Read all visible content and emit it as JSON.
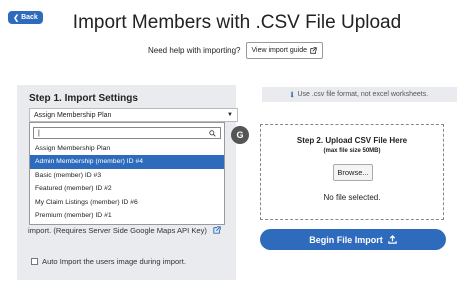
{
  "header": {
    "back_label": "Back",
    "title": "Import Members with .CSV File Upload",
    "help_text": "Need help with importing?",
    "guide_label": "View import guide"
  },
  "settings": {
    "title": "Step 1. Import Settings",
    "plan_select_value": "Assign Membership Plan",
    "dropdown": {
      "search_value": "",
      "options": [
        "Assign Membership Plan",
        "Admin Membership (member) ID #4",
        "Basic (member) ID #3",
        "Featured (member) ID #2",
        "My Claim Listings (member) ID #6",
        "Premium (member) ID #1"
      ],
      "selected_index": 1
    },
    "geocode_text": "import. (Requires Server Side Google Maps API Key)",
    "auto_image_label": "Auto Import the users image during import."
  },
  "upload": {
    "notice": "Use .csv file format, not excel worksheets.",
    "title": "Step 2. Upload CSV File Here",
    "max_size": "(max file size 50MB)",
    "browse_label": "Browse...",
    "no_file": "No file selected.",
    "begin_label": "Begin File Import"
  },
  "colors": {
    "accent": "#2f6bbd",
    "panel": "#e9ebef"
  }
}
